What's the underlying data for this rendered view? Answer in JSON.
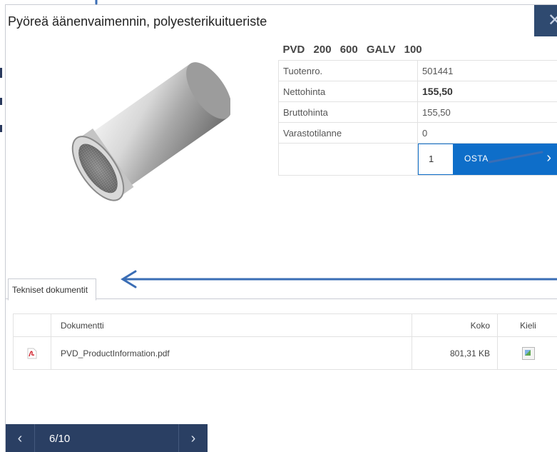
{
  "title": "Pyöreä äänenvaimennin, polyesterikuitueriste",
  "close_icon_glyph": "✕",
  "product": {
    "code": "PVD  200  600  GALV  100",
    "image": "cylindrical-silencer-photo",
    "specs": [
      {
        "label": "Tuotenro.",
        "value": "501441",
        "bold": false
      },
      {
        "label": "Nettohinta",
        "value": "155,50",
        "bold": true
      },
      {
        "label": "Bruttohinta",
        "value": "155,50",
        "bold": false
      },
      {
        "label": "Varastotilanne",
        "value": "0",
        "bold": false
      }
    ],
    "order": {
      "quantity": "1",
      "add_label": "OSTA",
      "chevron": "›"
    }
  },
  "tabs": [
    {
      "label": "Tekniset dokumentit"
    }
  ],
  "documents": {
    "headers": {
      "name": "Dokumentti",
      "size": "Koko",
      "language": "Kieli"
    },
    "rows": [
      {
        "icon": "pdf-icon",
        "name": "PVD_ProductInformation.pdf",
        "size": "801,31 KB",
        "language_icon": "broken-image-icon"
      }
    ]
  },
  "footer": {
    "prev": "‹",
    "counter": "6/10",
    "next": "›"
  },
  "colors": {
    "accent_blue": "#0e6ec9",
    "nav_dark": "#2a3f63",
    "annotation_arrow": "#3a6db5"
  }
}
